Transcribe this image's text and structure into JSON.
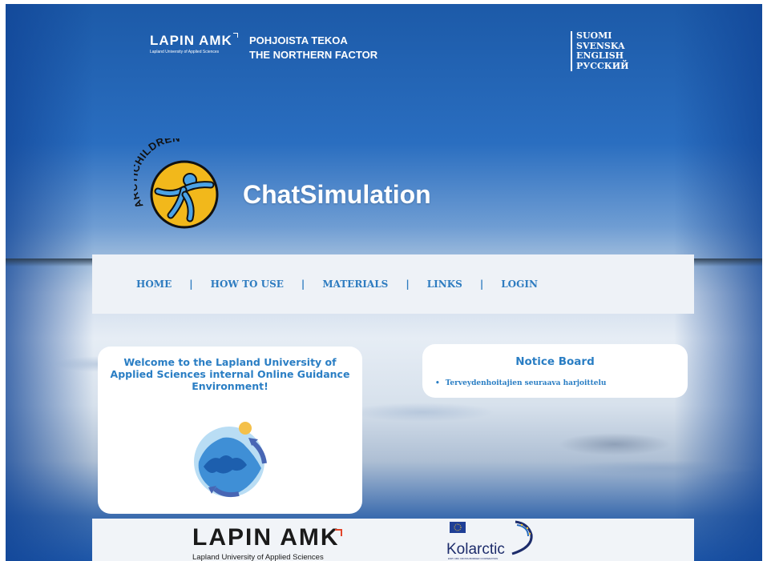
{
  "header": {
    "logo_word": "LAPIN AMK",
    "logo_sub": "Lapland University of Applied Sciences",
    "tagline": [
      "POHJOISTA TEKOA",
      "THE NORTHERN FACTOR"
    ],
    "languages": [
      "SUOMI",
      "SVENSKA",
      "ENGLISH",
      "РУССКИЙ"
    ]
  },
  "logo": {
    "arc_text": "ARCTICHILDREN"
  },
  "site_title": "ChatSimulation",
  "nav": {
    "items": [
      "HOME",
      "HOW TO USE",
      "MATERIALS",
      "LINKS",
      "LOGIN"
    ],
    "separator": "|"
  },
  "welcome": {
    "title": "Welcome to the Lapland University of Applied Sciences internal Online Guidance Environment!"
  },
  "notice_board": {
    "title": "Notice Board",
    "items": [
      "Terveydenhoitajien seuraava harjoittelu"
    ],
    "bullet": "•"
  },
  "footer": {
    "lapin_word": "LAPIN AMK",
    "lapin_sub": "Lapland University of Applied Sciences",
    "kolarctic_word": "Kolarctic",
    "kolarctic_sub": "ENPI CBC CROSS-BORDER COOPERATION"
  },
  "colors": {
    "accent": "#2a7ec4",
    "logo_yellow": "#f2b81b",
    "nav_bg": "#eef2f7"
  }
}
